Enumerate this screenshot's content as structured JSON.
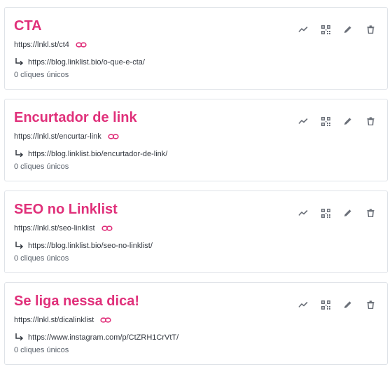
{
  "colors": {
    "accent": "#e0307a",
    "text": "#333840",
    "muted": "#59616b",
    "icon": "#6b7079",
    "border": "#dfe3e8"
  },
  "icons": {
    "copy": "link-icon",
    "redirect": "arrow-down-right-icon",
    "stats": "chart-icon",
    "qr": "qr-code-icon",
    "edit": "pencil-icon",
    "delete": "trash-icon"
  },
  "links": [
    {
      "title": "CTA",
      "short_url": "https://lnkl.st/ct4",
      "destination": "https://blog.linklist.bio/o-que-e-cta/",
      "clicks": "0 cliques únicos"
    },
    {
      "title": "Encurtador de link",
      "short_url": "https://lnkl.st/encurtar-link",
      "destination": "https://blog.linklist.bio/encurtador-de-link/",
      "clicks": "0 cliques únicos"
    },
    {
      "title": "SEO no Linklist",
      "short_url": "https://lnkl.st/seo-linklist",
      "destination": "https://blog.linklist.bio/seo-no-linklist/",
      "clicks": "0 cliques únicos"
    },
    {
      "title": "Se liga nessa dica!",
      "short_url": "https://lnkl.st/dicalinklist",
      "destination": "https://www.instagram.com/p/CtZRH1CrVtT/",
      "clicks": "0 cliques únicos"
    }
  ]
}
